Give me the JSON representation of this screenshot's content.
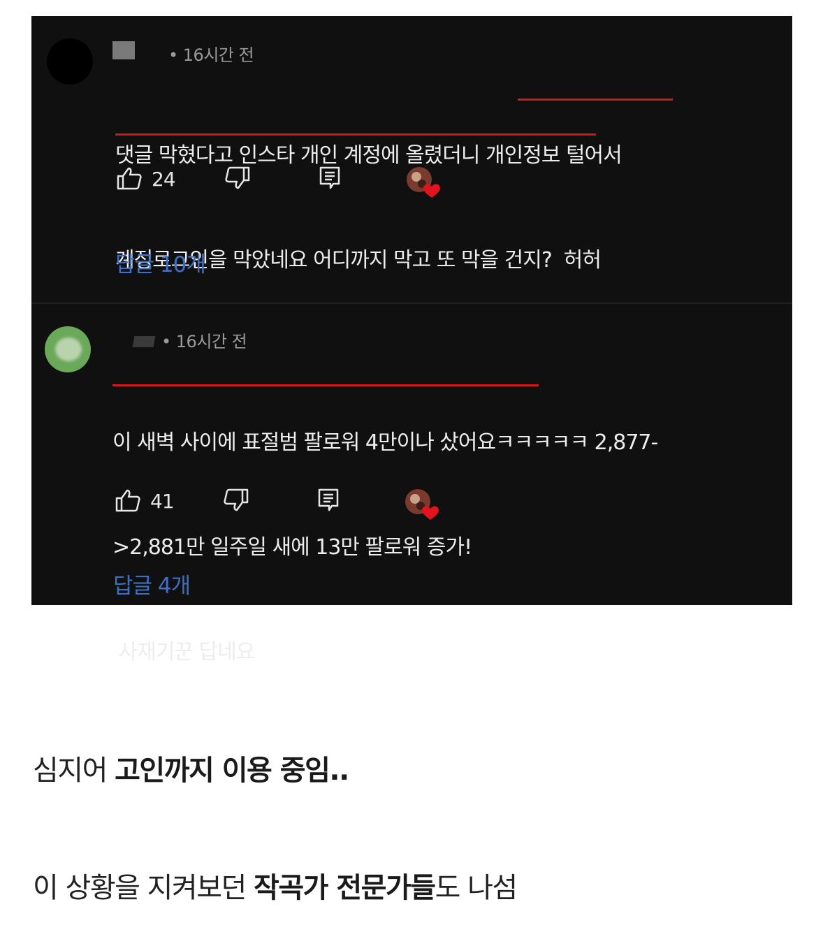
{
  "comments": [
    {
      "time": "• 16시간 전",
      "lines": [
        "댓글 막혔다고 인스타 개인 계정에 올렸더니 개인정보 털어서",
        "계정로그인을 막았네요 어디까지 막고 또 막을 건지?  허허"
      ],
      "likes": "24",
      "replies": "답글 10개"
    },
    {
      "time": "• 16시간 전",
      "lines": [
        "이 새벽 사이에 표절범 팔로워 4만이나 샀어요ㅋㅋㅋㅋㅋ 2,877-",
        ">2,881만 일주일 새에 13만 팔로워 증가!",
        " 사재기꾼 답네요"
      ],
      "likes": "41",
      "replies": "답글 4개"
    }
  ],
  "captions": [
    {
      "plain_before": "심지어 ",
      "bold": "고인까지 이용 중임..",
      "plain_after": ""
    },
    {
      "plain_before": "이 상황을 지켜보던 ",
      "bold": "작곡가 전문가들",
      "plain_after": "도 나섬"
    }
  ],
  "colors": {
    "panel": "#101010",
    "reply_link": "#3e6fc7",
    "underline": "#d01818"
  },
  "icons": [
    "thumbs-up-icon",
    "thumbs-down-icon",
    "reply-icon",
    "creator-heart-icon"
  ]
}
